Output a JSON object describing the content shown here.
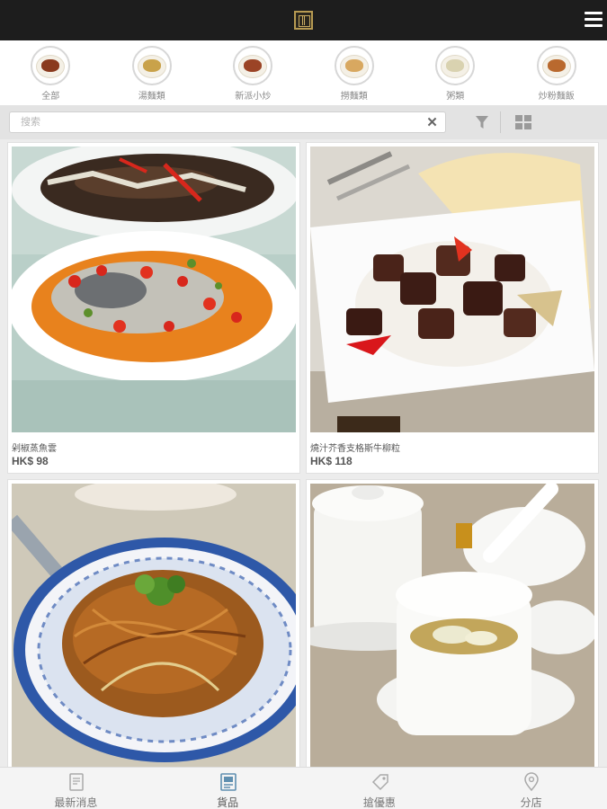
{
  "header": {
    "logo_icon": "brand-seal-icon",
    "menu_icon": "hamburger-menu-icon"
  },
  "categories": [
    {
      "label": "全部",
      "color": "#8a3a1e"
    },
    {
      "label": "湯麵類",
      "color": "#c9a24a"
    },
    {
      "label": "新派小炒",
      "color": "#9b4426"
    },
    {
      "label": "撈麵類",
      "color": "#d8a860"
    },
    {
      "label": "粥類",
      "color": "#d9d2b0"
    },
    {
      "label": "炒粉麵飯",
      "color": "#b9692e"
    }
  ],
  "search": {
    "placeholder": "搜索",
    "value": "",
    "clear_icon": "clear-x-icon",
    "filter_icon": "filter-funnel-icon",
    "grid_icon": "grid-view-icon"
  },
  "products": [
    {
      "name": "剁椒蒸魚雲",
      "price": "HK$ 98"
    },
    {
      "name": "燒汁芥香支格斯牛柳粒",
      "price": "HK$ 118"
    },
    {
      "name": "",
      "price": ""
    },
    {
      "name": "",
      "price": ""
    }
  ],
  "bottom_nav": [
    {
      "label": "最新消息",
      "icon": "news-document-icon"
    },
    {
      "label": "貨品",
      "icon": "product-book-icon",
      "active": true
    },
    {
      "label": "搶優惠",
      "icon": "coupon-tag-icon"
    },
    {
      "label": "分店",
      "icon": "location-pin-icon"
    }
  ],
  "colors": {
    "topbar": "#1d1d1d",
    "active_nav": "#5f8fb0",
    "inactive_nav": "#a9a9a9"
  }
}
